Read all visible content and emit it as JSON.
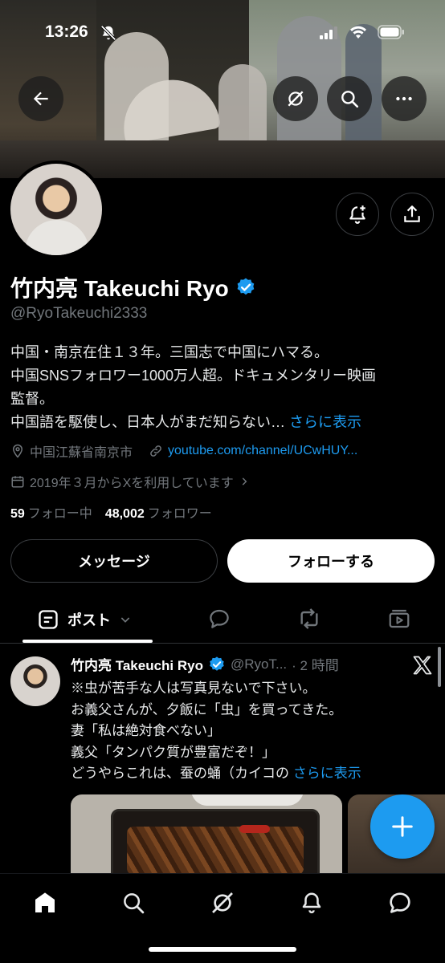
{
  "status_bar": {
    "time": "13:26"
  },
  "profile": {
    "name": "竹内亮 Takeuchi Ryo",
    "handle": "@RyoTakeuchi2333",
    "bio_lines": [
      "中国・南京在住１３年。三国志で中国にハマる。",
      "中国SNSフォロワー1000万人超。ドキュメンタリー映画",
      "監督。",
      "中国語を駆使し、日本人がまだ知らない… "
    ],
    "bio_more": "さらに表示",
    "location": "中国江蘇省南京市",
    "website": "youtube.com/channel/UCwHUY...",
    "joined": "2019年３月からXを利用しています",
    "following_count": "59",
    "following_label": "フォロー中",
    "followers_count": "48,002",
    "followers_label": "フォロワー"
  },
  "buttons": {
    "message": "メッセージ",
    "follow": "フォローする"
  },
  "tabs": {
    "posts_label": "ポスト"
  },
  "tweet": {
    "name": "竹内亮 Takeuchi Ryo",
    "handle": "@RyoT...",
    "time": "· 2 時間",
    "lines": [
      "※虫が苦手な人は写真見ないで下さい。",
      "お義父さんが、夕飯に「虫」を買ってきた。",
      "妻「私は絶対食べない」",
      "義父「タンパク質が豊富だぞ！」",
      "どうやらこれは、蚕の蛹（カイコの "
    ],
    "more": "さらに表示"
  },
  "colors": {
    "accent": "#1d9bf0",
    "background": "#000000",
    "muted": "#71767b"
  }
}
